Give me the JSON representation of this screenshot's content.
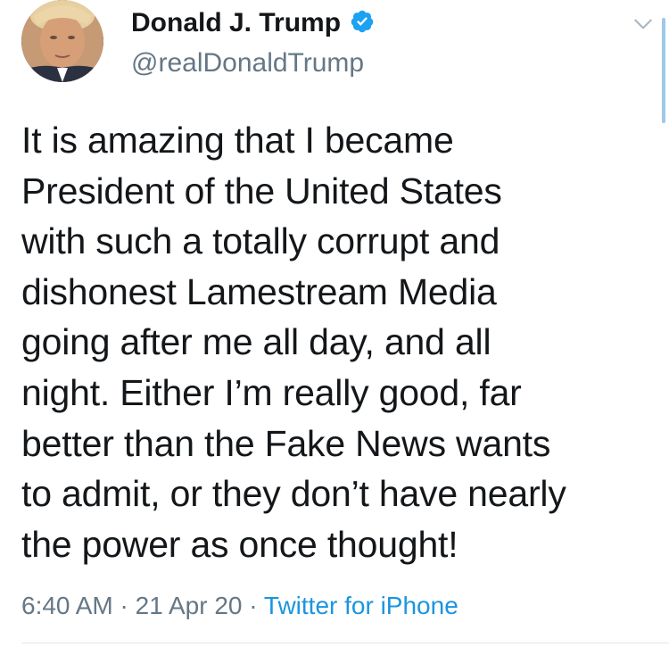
{
  "tweet": {
    "author": {
      "display_name": "Donald J. Trump",
      "handle": "@realDonaldTrump",
      "verified": true
    },
    "text": "It is amazing that I became\nPresident of the United States\nwith such a totally corrupt and\ndishonest Lamestream Media\ngoing after me all day, and all\nnight. Either I’m really good, far\nbetter than the Fake News wants\nto admit, or they don’t have nearly\nthe power as once thought!",
    "time": "6:40 AM",
    "separator": "·",
    "date": "21 Apr 20",
    "source": "Twitter for iPhone"
  },
  "icons": {
    "verified": "verified-badge-icon",
    "menu": "chevron-down-icon"
  },
  "colors": {
    "text": "#14171a",
    "secondary": "#657786",
    "link": "#1b95e0",
    "verified": "#1da1f2"
  }
}
